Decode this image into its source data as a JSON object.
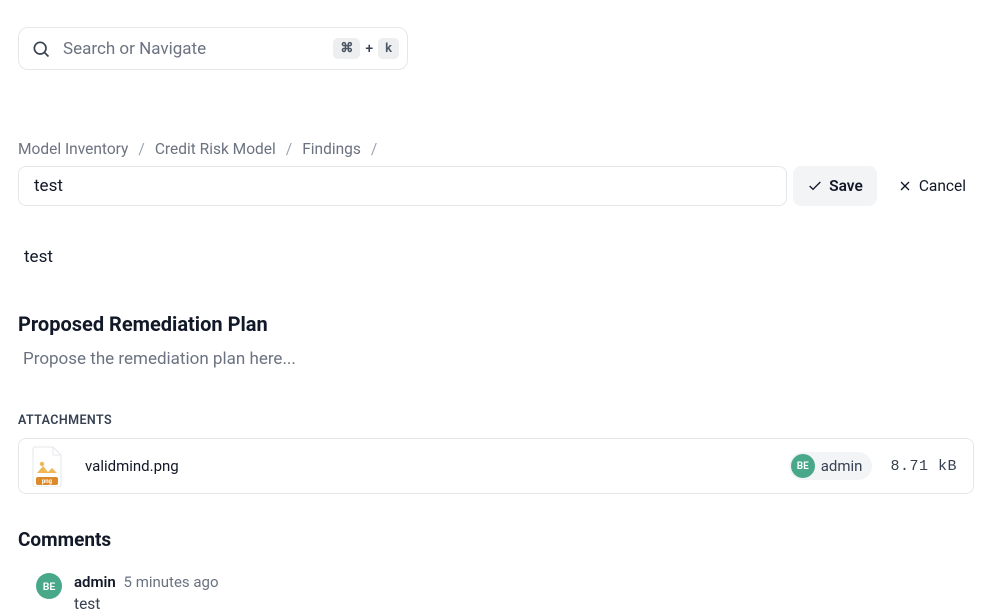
{
  "search": {
    "placeholder": "Search or Navigate",
    "shortcut": {
      "mod": "⌘",
      "plus": "+",
      "key": "k"
    }
  },
  "breadcrumbs": [
    "Model Inventory",
    "Credit Risk Model",
    "Findings"
  ],
  "title_value": "test",
  "actions": {
    "save": "Save",
    "cancel": "Cancel"
  },
  "body_text": "test",
  "remediation": {
    "heading": "Proposed Remediation Plan",
    "placeholder": "Propose the remediation plan here..."
  },
  "attachments": {
    "label": "ATTACHMENTS",
    "items": [
      {
        "filename": "validmind.png",
        "user_initials": "BE",
        "user_name": "admin",
        "size": "8.71 kB"
      }
    ]
  },
  "comments": {
    "heading": "Comments",
    "items": [
      {
        "user_initials": "BE",
        "user_name": "admin",
        "time": "5 minutes ago",
        "body": "test"
      }
    ]
  }
}
